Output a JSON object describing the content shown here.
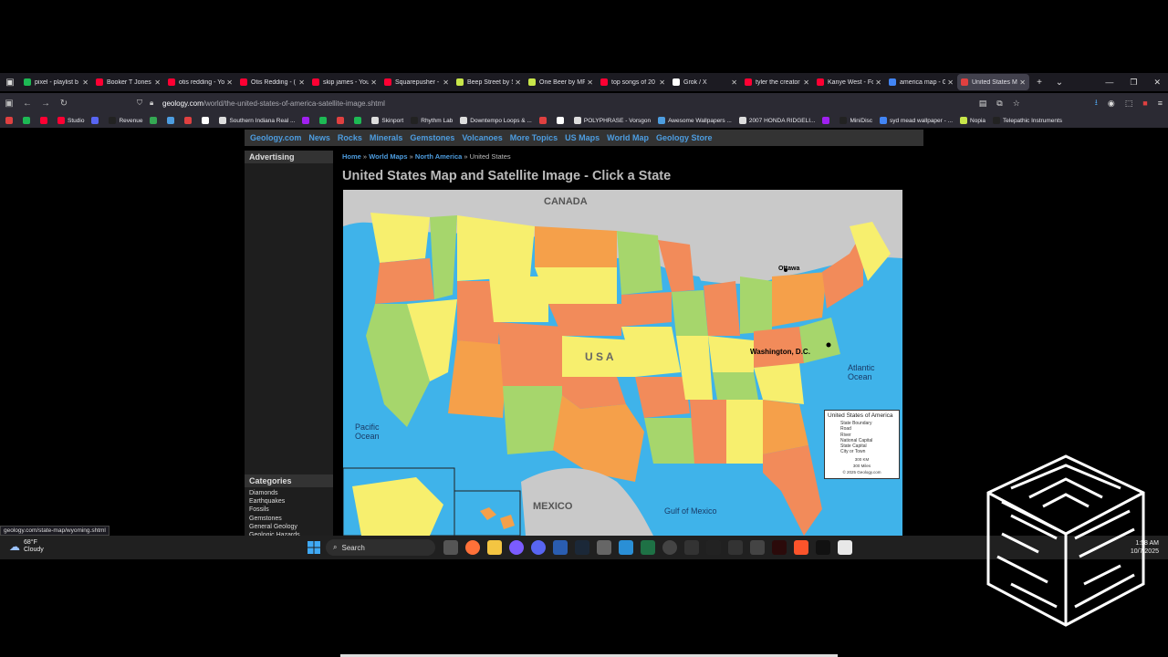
{
  "tabs": [
    {
      "label": "pixel - playlist b",
      "color": "#1db954",
      "active": false
    },
    {
      "label": "Booker T Jones",
      "color": "#ff0033",
      "active": false
    },
    {
      "label": "otis redding - Yo",
      "color": "#ff0033",
      "active": false
    },
    {
      "label": "Otis Redding - (",
      "color": "#ff0033",
      "active": false
    },
    {
      "label": "skip james - You",
      "color": "#ff0033",
      "active": false
    },
    {
      "label": "Squarepusher -",
      "color": "#ff0033",
      "active": false
    },
    {
      "label": "Beep Street by S",
      "color": "#c8e64a",
      "active": false
    },
    {
      "label": "One Beer by MF",
      "color": "#c8e64a",
      "active": false
    },
    {
      "label": "top songs of 20",
      "color": "#ff0033",
      "active": false
    },
    {
      "label": "Grok / X",
      "color": "#ffffff",
      "active": false
    },
    {
      "label": "tyler the creator",
      "color": "#ff0033",
      "active": false
    },
    {
      "label": "Kanye West - Fo",
      "color": "#ff0033",
      "active": false
    },
    {
      "label": "america map - G",
      "color": "#4285f4",
      "active": false
    },
    {
      "label": "United States M",
      "color": "#e04040",
      "active": true
    }
  ],
  "url": {
    "domain": "geology.com",
    "path": "/world/the-united-states-of-america-satellite-image.shtml"
  },
  "bookmarks": [
    {
      "label": "",
      "color": "#e04040"
    },
    {
      "label": "",
      "color": "#1db954"
    },
    {
      "label": "",
      "color": "#ff0033"
    },
    {
      "label": "Studio",
      "color": "#ff0033"
    },
    {
      "label": "",
      "color": "#5865f2"
    },
    {
      "label": "Revenue",
      "color": "#222"
    },
    {
      "label": "",
      "color": "#34a853"
    },
    {
      "label": "",
      "color": "#4d9de0"
    },
    {
      "label": "",
      "color": "#e04040"
    },
    {
      "label": "",
      "color": "#fff"
    },
    {
      "label": "Southern Indiana Real ...",
      "color": "#ddd"
    },
    {
      "label": "",
      "color": "#a020f0"
    },
    {
      "label": "",
      "color": "#1db954"
    },
    {
      "label": "",
      "color": "#e04040"
    },
    {
      "label": "",
      "color": "#1db954"
    },
    {
      "label": "Skinport",
      "color": "#ddd"
    },
    {
      "label": "Rhythm Lab",
      "color": "#222"
    },
    {
      "label": "Downtempo Loops & ...",
      "color": "#ddd"
    },
    {
      "label": "",
      "color": "#e04040"
    },
    {
      "label": "",
      "color": "#fff"
    },
    {
      "label": "POLYPHRASE - Vorsgon",
      "color": "#ddd"
    },
    {
      "label": "Awesome Wallpapers ...",
      "color": "#4d9de0"
    },
    {
      "label": "2007 HONDA RIDGELI...",
      "color": "#ddd"
    },
    {
      "label": "",
      "color": "#a020f0"
    },
    {
      "label": "MiniDisc",
      "color": "#222"
    },
    {
      "label": "syd mead wallpaper - ...",
      "color": "#4285f4"
    },
    {
      "label": "Nopia",
      "color": "#c8e64a"
    },
    {
      "label": "Telepathic Instruments",
      "color": "#222"
    }
  ],
  "site_nav": [
    "Geology.com",
    "News",
    "Rocks",
    "Minerals",
    "Gemstones",
    "Volcanoes",
    "More Topics",
    "US Maps",
    "World Map",
    "Geology Store"
  ],
  "sidebar": {
    "advertising": "Advertising",
    "categories_head": "Categories",
    "categories": [
      "Diamonds",
      "Earthquakes",
      "Fossils",
      "Gemstones",
      "General Geology",
      "Geologic Hazards"
    ]
  },
  "breadcrumb": {
    "home": "Home",
    "sep": " » ",
    "world_maps": "World Maps",
    "north_america": "North America",
    "current": "United States"
  },
  "page_title": "United States Map and Satellite Image - Click a State",
  "map": {
    "labels": {
      "canada": "CANADA",
      "usa": "U S A",
      "mexico": "MEXICO",
      "pacific": "Pacific Ocean",
      "atlantic": "Atlantic Ocean",
      "gulf": "Gulf of Mexico",
      "washington": "Washington, D.C.",
      "ottawa": "Ottawa"
    },
    "legend": {
      "title": "United States of America",
      "items": [
        "State Boundary",
        "Road",
        "River",
        "National Capital",
        "State Capital",
        "City or Town"
      ],
      "scale_km": "300 KM",
      "scale_mi": "300 Miles",
      "copyright": "© 2025 Geology.com"
    }
  },
  "status_url": "geology.com/state-map/wyoming.shtml",
  "taskbar": {
    "temp": "68°F",
    "weather": "Cloudy",
    "search": "Search",
    "time": "1:58 AM",
    "date": "10/7/2025"
  },
  "colors": {
    "link": "#4d9de0",
    "ocean": "#3fb3ea",
    "canada": "#c8c8c8"
  }
}
